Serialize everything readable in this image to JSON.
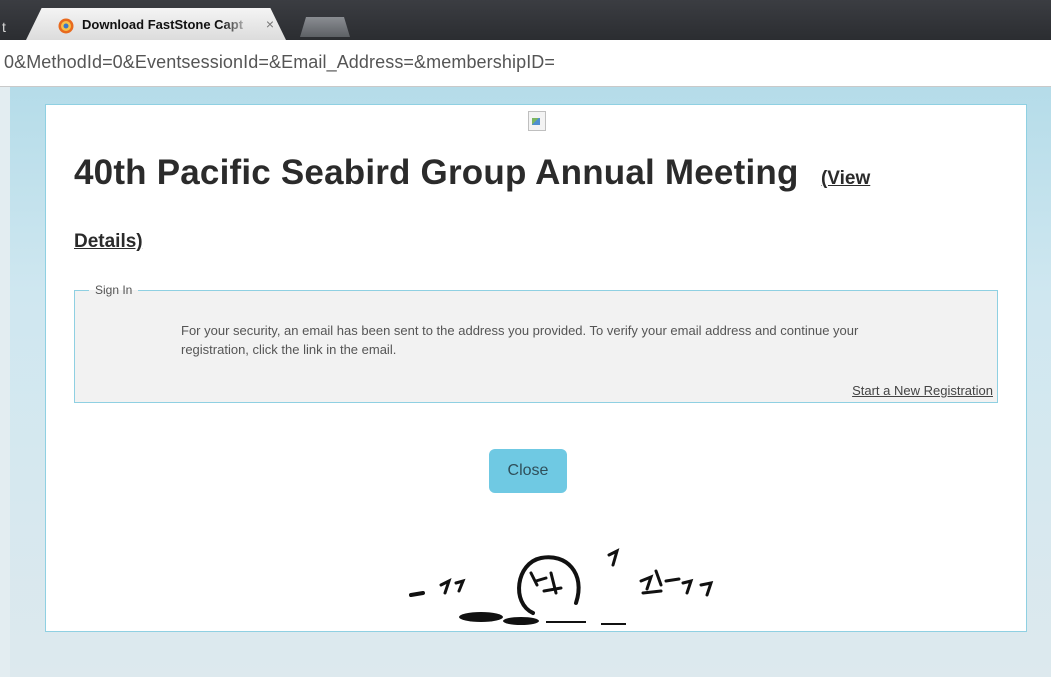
{
  "browser": {
    "tab_edge": "t",
    "tab_title": "Download FastStone Capt",
    "tab_close": "×",
    "url": "0&MethodId=0&EventsessionId=&Email_Address=&membershipID="
  },
  "event": {
    "title": "40th Pacific Seabird Group Annual Meeting",
    "view_link_part1": "(View",
    "view_link_part2": "Details)"
  },
  "signin": {
    "legend": "Sign In",
    "message": "For your security, an email has been sent to the address you provided. To verify your email address and continue your registration, click the link in the email.",
    "new_registration_link": "Start a New Registration"
  },
  "actions": {
    "close_label": "Close"
  },
  "colors": {
    "accent": "#6fc9e3",
    "border": "#8fd0e2",
    "background": "#cfe7f0"
  },
  "icons": {
    "tab_favicon": "faststone-favicon",
    "page_image": "broken-image-icon",
    "footer_logo": "seabird-logo"
  }
}
